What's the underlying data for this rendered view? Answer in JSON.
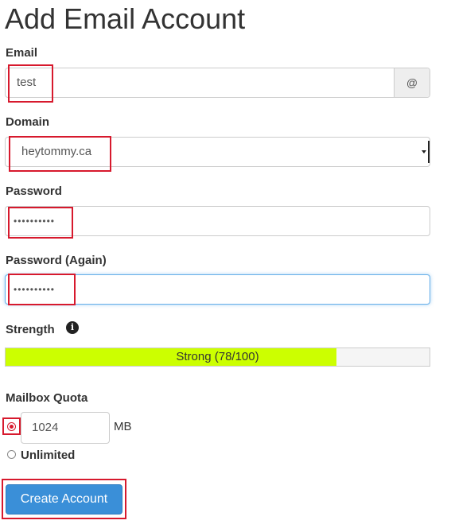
{
  "page": {
    "title": "Add Email Account"
  },
  "email": {
    "label": "Email",
    "value": "test",
    "suffix": "@"
  },
  "domain": {
    "label": "Domain",
    "selected": "heytommy.ca"
  },
  "password": {
    "label": "Password",
    "masked_value": "••••••••••"
  },
  "password_again": {
    "label": "Password (Again)",
    "masked_value": "••••••••••"
  },
  "strength": {
    "label": "Strength",
    "info_icon": "info-circle-icon",
    "text": "Strong (78/100)",
    "score": 78,
    "max": 100,
    "color": "#ccff00"
  },
  "quota": {
    "label": "Mailbox Quota",
    "value": "1024",
    "unit": "MB",
    "unlimited_label": "Unlimited",
    "selected_option": "limited"
  },
  "actions": {
    "create_label": "Create Account"
  },
  "colors": {
    "highlight": "#d7192d",
    "primary_button": "#3a8fd8"
  }
}
